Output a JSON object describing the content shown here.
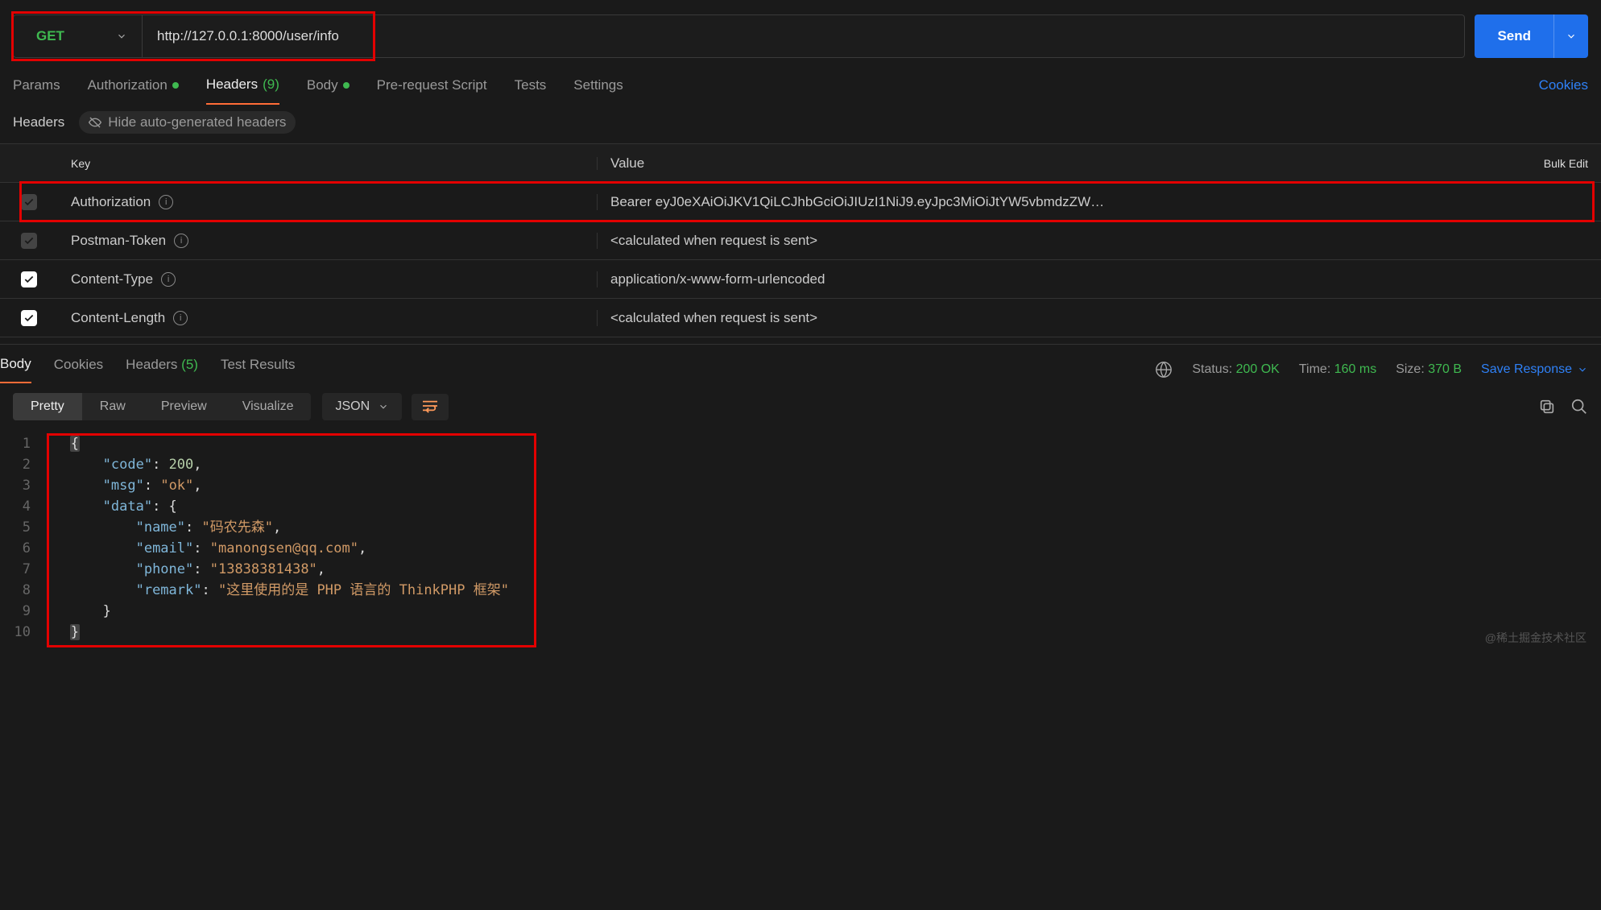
{
  "request": {
    "method": "GET",
    "url": "http://127.0.0.1:8000/user/info",
    "send_label": "Send"
  },
  "req_tabs": {
    "params": "Params",
    "authorization": "Authorization",
    "headers": "Headers",
    "headers_count": "(9)",
    "body": "Body",
    "prerequest": "Pre-request Script",
    "tests": "Tests",
    "settings": "Settings",
    "cookies": "Cookies"
  },
  "headers_section": {
    "title": "Headers",
    "hide_label": "Hide auto-generated headers",
    "key_header": "Key",
    "value_header": "Value",
    "bulk_edit": "Bulk Edit",
    "rows": [
      {
        "key": "Authorization",
        "value": "Bearer eyJ0eXAiOiJKV1QiLCJhbGciOiJIUzI1NiJ9.eyJpc3MiOiJtYW5vbmdzZW…",
        "checked": "dim",
        "highlight": true
      },
      {
        "key": "Postman-Token",
        "value": "<calculated when request is sent>",
        "checked": "dim"
      },
      {
        "key": "Content-Type",
        "value": "application/x-www-form-urlencoded",
        "checked": "on"
      },
      {
        "key": "Content-Length",
        "value": "<calculated when request is sent>",
        "checked": "on"
      }
    ]
  },
  "response_tabs": {
    "body": "Body",
    "cookies": "Cookies",
    "headers": "Headers",
    "headers_count": "(5)",
    "test_results": "Test Results"
  },
  "status": {
    "status_label": "Status:",
    "status_value": "200 OK",
    "time_label": "Time:",
    "time_value": "160 ms",
    "size_label": "Size:",
    "size_value": "370 B",
    "save_response": "Save Response"
  },
  "body_toolbar": {
    "pretty": "Pretty",
    "raw": "Raw",
    "preview": "Preview",
    "visualize": "Visualize",
    "format": "JSON"
  },
  "response_json": {
    "line1": "{",
    "line2_k": "\"code\"",
    "line2_v": "200",
    "line3_k": "\"msg\"",
    "line3_v": "\"ok\"",
    "line4_k": "\"data\"",
    "line5_k": "\"name\"",
    "line5_v": "\"码农先森\"",
    "line6_k": "\"email\"",
    "line6_v": "\"manongsen@qq.com\"",
    "line7_k": "\"phone\"",
    "line7_v": "\"13838381438\"",
    "line8_k": "\"remark\"",
    "line8_v": "\"这里使用的是 PHP 语言的 ThinkPHP 框架\"",
    "line10": "}"
  },
  "watermark": "@稀土掘金技术社区"
}
